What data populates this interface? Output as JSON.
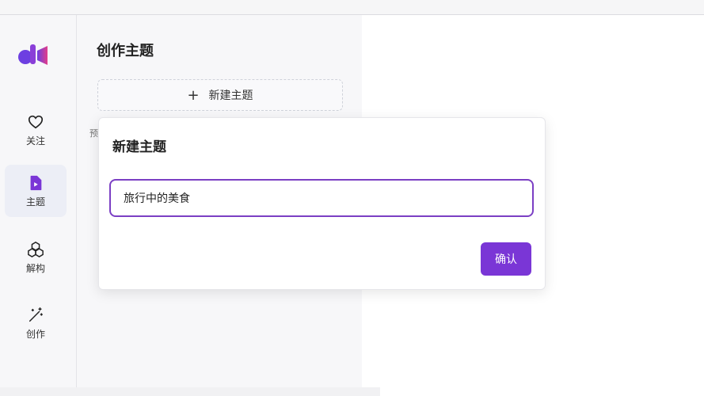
{
  "nav": {
    "items": [
      {
        "label": "关注",
        "icon": "heart-icon"
      },
      {
        "label": "主题",
        "icon": "document-play-icon"
      },
      {
        "label": "解构",
        "icon": "cubes-icon"
      },
      {
        "label": "创作",
        "icon": "magic-wand-icon"
      }
    ],
    "active": "主题"
  },
  "panel": {
    "title": "创作主题",
    "new_topic_label": "新建主题",
    "partial_text": "预"
  },
  "dialog": {
    "title": "新建主题",
    "input_value": "旅行中的美食",
    "confirm_label": "确认"
  },
  "colors": {
    "accent": "#7a36d6",
    "logo_blue": "#3b5bdb",
    "logo_pink": "#e64980"
  }
}
